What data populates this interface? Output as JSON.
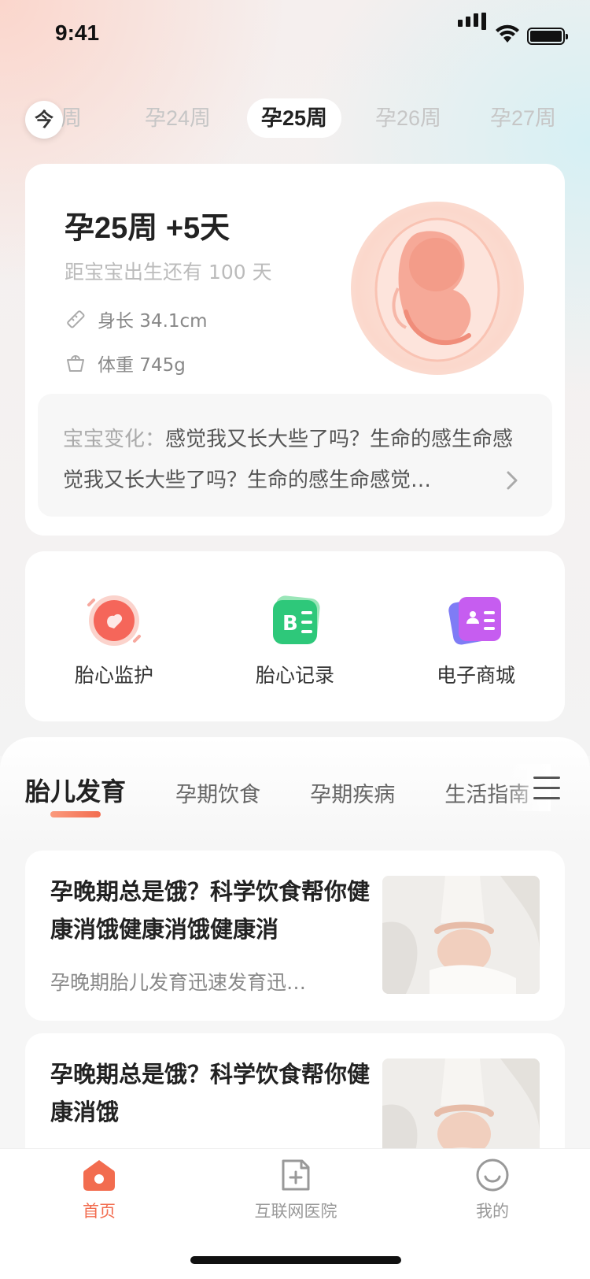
{
  "status_bar": {
    "time": "9:41"
  },
  "week_selector": {
    "today_label": "今",
    "weeks": [
      "孕23周",
      "孕24周",
      "孕25周",
      "孕26周",
      "孕27周"
    ],
    "partial_first": "3周",
    "active": "孕25周"
  },
  "pregnancy_card": {
    "title": "孕25周 +5天",
    "countdown": "距宝宝出生还有 100 天",
    "length": "身长 34.1cm",
    "weight": "体重 745g",
    "change_label": "宝宝变化：",
    "change_text": "感觉我又长大些了吗？生命的感生命感觉我又长大些了吗？生命的感生命感觉…"
  },
  "shortcuts": [
    {
      "label": "胎心监护",
      "icon": "fetal-monitor-icon"
    },
    {
      "label": "胎心记录",
      "icon": "fetal-record-icon"
    },
    {
      "label": "电子商城",
      "icon": "shop-icon"
    }
  ],
  "category_tabs": {
    "items": [
      "胎儿发育",
      "孕期饮食",
      "孕期疾病",
      "生活指南"
    ],
    "active": "胎儿发育"
  },
  "articles": [
    {
      "title": "孕晚期总是饿？科学饮食帮你健康消饿健康消饿健康消",
      "description": "孕晚期胎儿发育迅速发育迅…"
    },
    {
      "title": "孕晚期总是饿？科学饮食帮你健康消饿",
      "description": ""
    }
  ],
  "bottom_nav": [
    {
      "label": "首页",
      "icon": "home-icon",
      "active": true
    },
    {
      "label": "互联网医院",
      "icon": "hospital-icon",
      "active": false
    },
    {
      "label": "我的",
      "icon": "profile-icon",
      "active": false
    }
  ],
  "colors": {
    "accent": "#f26c4f",
    "tab_underline": "#f26c4f",
    "shop_icon": "#b45cf0",
    "record_icon": "#2ec87a"
  }
}
